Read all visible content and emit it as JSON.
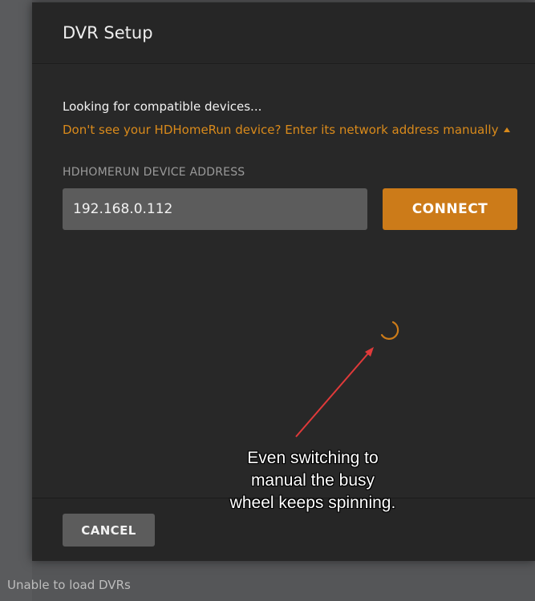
{
  "modal": {
    "title": "DVR Setup",
    "status_text": "Looking for compatible devices...",
    "manual_link": "Don't see your HDHomeRun device? Enter its network address manually",
    "manual_link_icon": "caret-up-icon",
    "field_label": "HDHOMERUN DEVICE ADDRESS",
    "address_value": "192.168.0.112",
    "connect_label": "CONNECT",
    "cancel_label": "CANCEL",
    "spinner_icon": "loading-spinner-icon"
  },
  "footer_status": "Unable to load DVRs",
  "annotation": {
    "line1": "Even switching to",
    "line2": "manual the busy",
    "line3": "wheel keeps spinning."
  },
  "colors": {
    "accent": "#cc7b19",
    "link": "#d98a1b",
    "annotation_arrow": "#e03a3a"
  }
}
